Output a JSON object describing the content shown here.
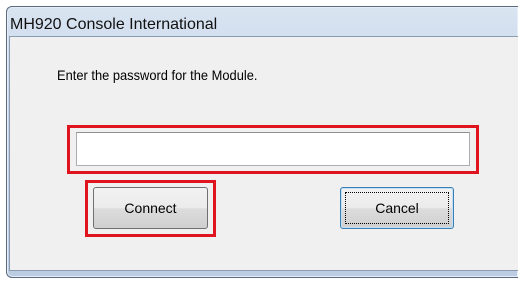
{
  "window": {
    "title": "MH920 Console International"
  },
  "dialog": {
    "prompt": "Enter the password for the Module.",
    "password_value": "",
    "connect_label": "Connect",
    "cancel_label": "Cancel"
  },
  "colors": {
    "highlight": "#e0141e",
    "dialog_background": "#f0f0f0",
    "titlebar": "#c3d3e8"
  }
}
